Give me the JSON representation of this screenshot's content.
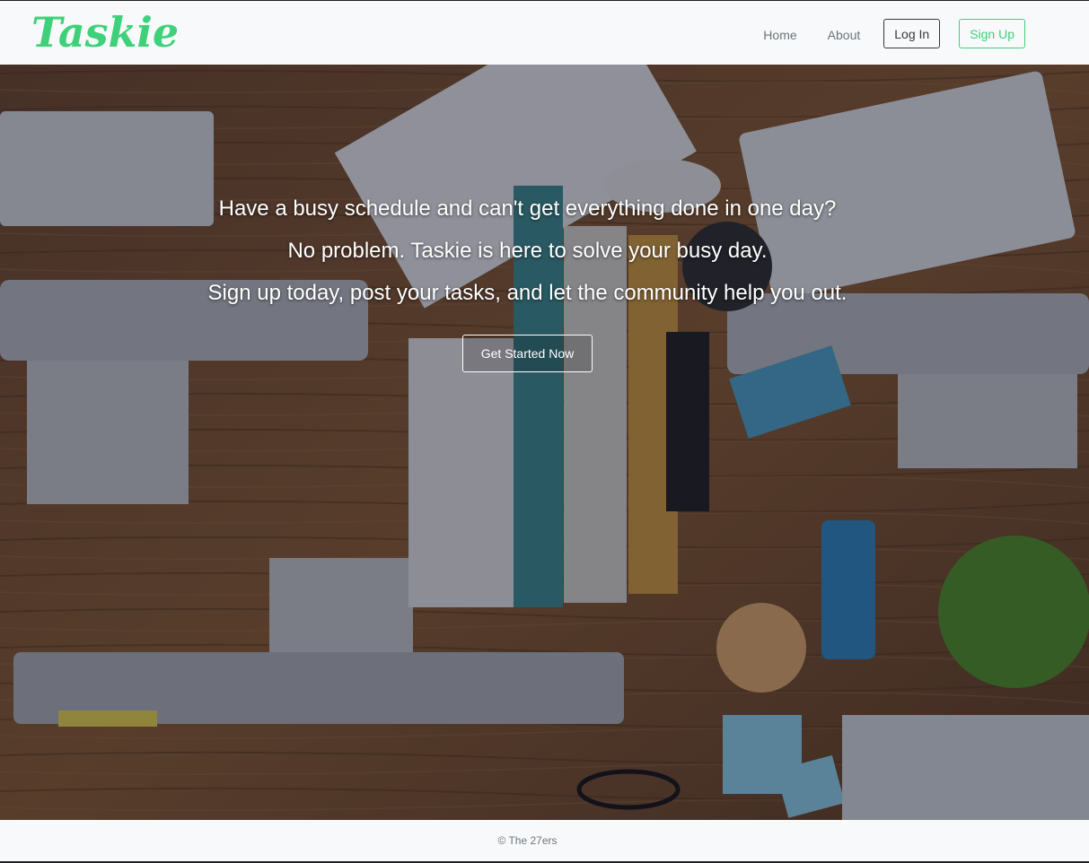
{
  "navbar": {
    "brand": "Taskie",
    "links": {
      "home": "Home",
      "about": "About"
    },
    "login_label": "Log In",
    "signup_label": "Sign Up"
  },
  "hero": {
    "lines": [
      "Have a busy schedule and can't get everything done in one day?",
      "No problem. Taskie is here to solve your busy day.",
      "Sign up today, post your tasks, and let the community help you out."
    ],
    "cta_label": "Get Started Now"
  },
  "footer": {
    "copyright": "© The 27ers"
  },
  "colors": {
    "brand": "#3fd17a",
    "navbar_bg": "#f8f9fa",
    "text_muted": "#6c757d"
  }
}
